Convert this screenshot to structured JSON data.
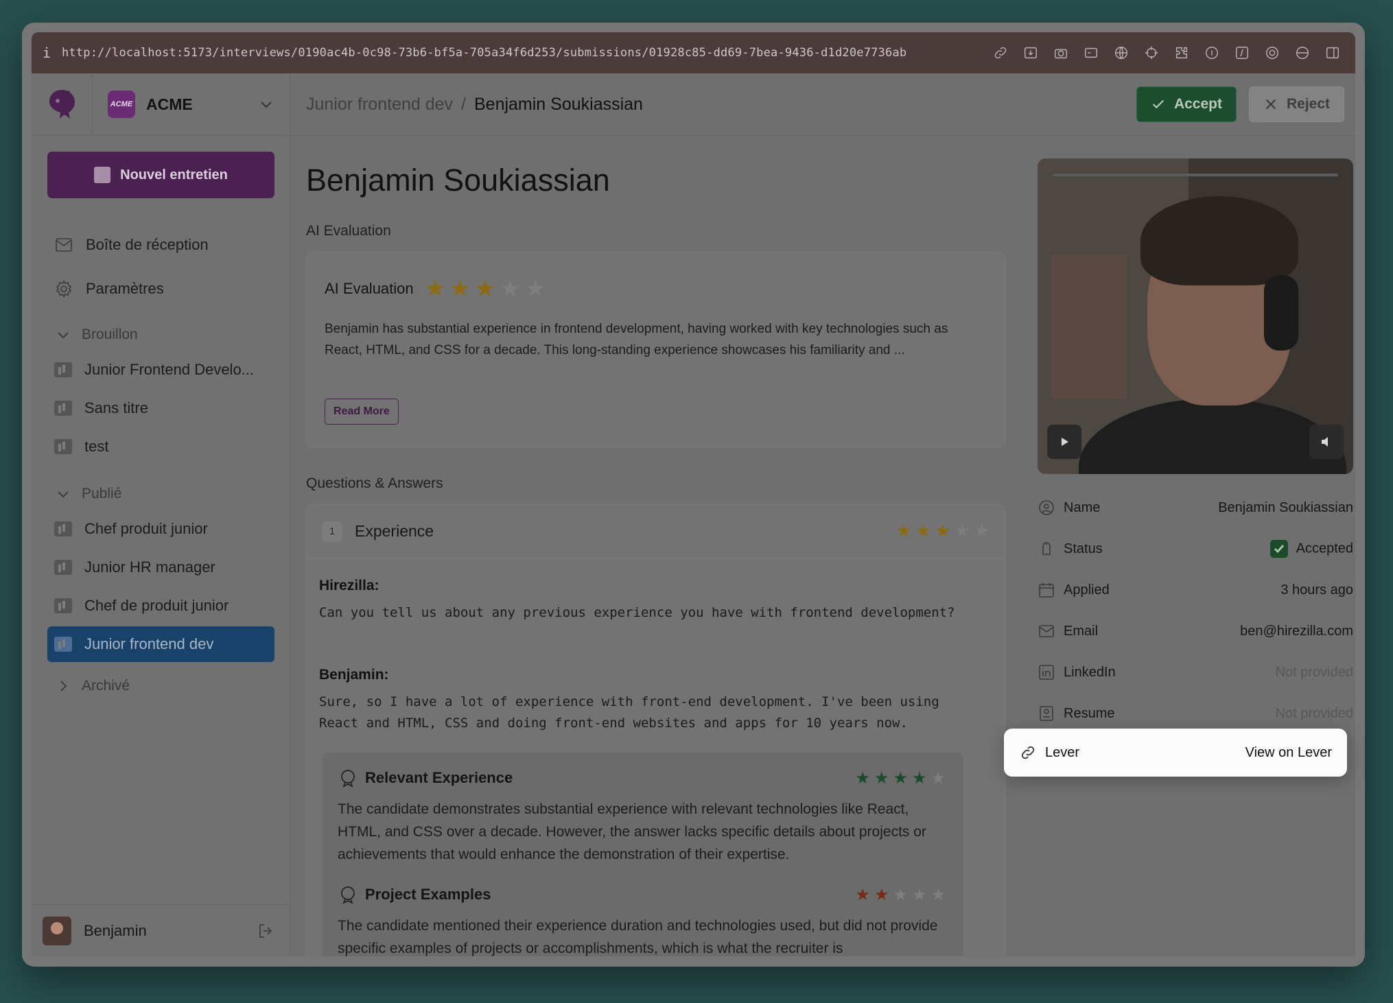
{
  "browser": {
    "url": "http://localhost:5173/interviews/0190ac4b-0c98-73b6-bf5a-705a34f6d253/submissions/01928c85-dd69-7bea-9436-d1d20e7736ab",
    "info_glyph": "i"
  },
  "sidebar": {
    "org_name": "ACME",
    "org_badge": "ACME",
    "new_button": "Nouvel entretien",
    "nav": [
      {
        "label": "Boîte de réception",
        "icon": "inbox-icon"
      },
      {
        "label": "Paramètres",
        "icon": "gear-icon"
      }
    ],
    "sections": {
      "draft": {
        "label": "Brouillon",
        "items": [
          "Junior Frontend Develo...",
          "Sans titre",
          "test"
        ]
      },
      "published": {
        "label": "Publié",
        "items": [
          "Chef produit junior",
          "Junior HR manager",
          "Chef de produit junior",
          "Junior frontend dev"
        ]
      },
      "archived": {
        "label": "Archivé"
      }
    },
    "active_item": "Junior frontend dev",
    "user_name": "Benjamin"
  },
  "header": {
    "breadcrumb_parent": "Junior frontend dev",
    "breadcrumb_sep": "/",
    "breadcrumb_current": "Benjamin Soukiassian",
    "accept_label": "Accept",
    "reject_label": "Reject"
  },
  "main": {
    "candidate_name": "Benjamin Soukiassian",
    "ai_section_title": "AI Evaluation",
    "ai_card_title": "AI Evaluation",
    "ai_rating": 3,
    "ai_summary": "Benjamin has substantial experience in frontend development, having worked with key technologies such as React, HTML, and CSS for a decade. This long-standing experience showcases his familiarity and ...",
    "read_more": "Read More",
    "qa_title": "Questions & Answers",
    "question": {
      "number": "1",
      "title": "Experience",
      "rating": 3,
      "interviewer_label": "Hirezilla:",
      "question_text": "Can you tell us about any previous experience you have with frontend development?",
      "candidate_label": "Benjamin:",
      "answer_text": "Sure, so I have a lot of experience with front-end development. I've been using React and HTML, CSS and doing front-end websites and apps for 10 years now.",
      "criteria": [
        {
          "title": "Relevant Experience",
          "rating": 4,
          "text": "The candidate demonstrates substantial experience with relevant technologies like React, HTML, and CSS over a decade. However, the answer lacks specific details about projects or achievements that would enhance the demonstration of their expertise."
        },
        {
          "title": "Project Examples",
          "rating": 2,
          "text": "The candidate mentioned their experience duration and technologies used, but did not provide specific examples of projects or accomplishments, which is what the recruiter is"
        }
      ]
    }
  },
  "details": {
    "rows": [
      {
        "label": "Name",
        "value": "Benjamin Soukiassian",
        "icon": "user-circle-icon"
      },
      {
        "label": "Status",
        "value": "Accepted",
        "icon": "status-icon"
      },
      {
        "label": "Applied",
        "value": "3 hours ago",
        "icon": "calendar-icon"
      },
      {
        "label": "Email",
        "value": "ben@hirezilla.com",
        "icon": "mail-icon"
      },
      {
        "label": "LinkedIn",
        "value": "Not provided",
        "icon": "linkedin-icon"
      },
      {
        "label": "Resume",
        "value": "Not provided",
        "icon": "resume-icon"
      }
    ],
    "lever": {
      "label": "Lever",
      "value": "View on Lever",
      "icon": "link-icon"
    }
  },
  "colors": {
    "brand": "#4a2150",
    "active_nav": "#19426b",
    "accept": "#1b4d2e",
    "star_gold": "#8a6a12",
    "star_green": "#1a4a2a",
    "star_red": "#7a2a16"
  }
}
